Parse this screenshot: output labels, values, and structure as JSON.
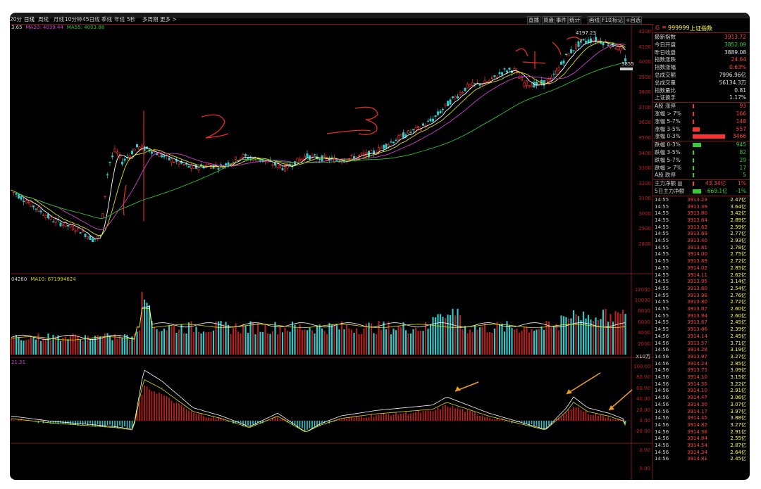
{
  "tabs": [
    "20分",
    "日线",
    "周线",
    "月线",
    "10分钟",
    "45日线",
    "季线",
    "年线",
    "5秒",
    "多周期",
    "更多 >"
  ],
  "right_tabs": [
    "直播",
    "買盘",
    "事件",
    "统计",
    "画线",
    "F10",
    "标记",
    "+自选"
  ],
  "legends": {
    "price": [
      {
        "text": "3.65",
        "color": "#d0d0d0"
      },
      {
        "text": "MA20: 4039.44",
        "color": "#d040d0"
      },
      {
        "text": "MA55: 4003.68",
        "color": "#30c030"
      }
    ],
    "volume": [
      {
        "text": "04280",
        "color": "#d0d0d0"
      },
      {
        "text": "MA10: 671994624",
        "color": "#d0d000"
      }
    ],
    "macd": [
      {
        "text": "21.31",
        "color": "#d040d0"
      }
    ],
    "peak_label": "4197.23",
    "right_label": "3855"
  },
  "price_axis": [
    "4200",
    "4100",
    "4000",
    "3900",
    "3800",
    "3700",
    "3600",
    "3500",
    "3400",
    "3300",
    "3200",
    "3100",
    "3000",
    "2900",
    "2800"
  ],
  "volume_axis": [
    "12000",
    "10000",
    "8000",
    "6000",
    "4000",
    "2000"
  ],
  "volume_unit": "X10万",
  "macd_axis": [
    "100.00",
    "80.00",
    "60.00",
    "40.00",
    "20.00",
    "0.00",
    "-20.00"
  ],
  "macd_axis_extra": [
    "0.00",
    "0.00"
  ],
  "index": {
    "code_prefix": "G",
    "code": "999999",
    "name": "上证指数"
  },
  "stats": [
    {
      "label": "最新指数",
      "value": "3913.72",
      "color": "#ff4040"
    },
    {
      "label": "今日开盘",
      "value": "3852.09",
      "color": "#30d030"
    },
    {
      "label": "昨日收盘",
      "value": "3889.08",
      "color": "#e0e0e0"
    },
    {
      "label": "指数涨跌",
      "value": "24.64",
      "color": "#ff4040"
    },
    {
      "label": "指数涨幅",
      "value": "0.63%",
      "color": "#ff4040"
    },
    {
      "label": "总成交额",
      "value": "7996.96亿",
      "color": "#e0e0e0"
    },
    {
      "label": "总成交量",
      "value": "56134.3万",
      "color": "#e0e0e0"
    },
    {
      "label": "指数量比",
      "value": "0.81",
      "color": "#e0e0e0"
    },
    {
      "label": "上证换手",
      "value": "1.17%",
      "color": "#e0e0e0"
    }
  ],
  "breadth": [
    {
      "label": "A股 涨停",
      "value": "93",
      "color": "#ff4040",
      "bar": 0.02,
      "bar_color": "#ff3030"
    },
    {
      "label": "涨幅 > 7%",
      "value": "166",
      "color": "#ff4040",
      "bar": 0.03,
      "bar_color": "#ff3030"
    },
    {
      "label": "涨幅 5-7%",
      "value": "148",
      "color": "#ff4040",
      "bar": 0.03,
      "bar_color": "#ff3030"
    },
    {
      "label": "涨幅 3-5%",
      "value": "557",
      "color": "#ff4040",
      "bar": 0.22,
      "bar_color": "#ff3030"
    },
    {
      "label": "涨幅 0-3%",
      "value": "3466",
      "color": "#ff4040",
      "bar": 1.0,
      "bar_color": "#ff3030"
    },
    {
      "label": "跌幅 0-3%",
      "value": "945",
      "color": "#30d030",
      "bar": 0.26,
      "bar_color": "#30d030"
    },
    {
      "label": "跌幅 3-5%",
      "value": "82",
      "color": "#30d030",
      "bar": 0.02,
      "bar_color": "#30d030"
    },
    {
      "label": "跌幅 5-7%",
      "value": "29",
      "color": "#30d030",
      "bar": 0.01,
      "bar_color": "#30d030"
    },
    {
      "label": "跌幅 > 7%",
      "value": "17",
      "color": "#30d030",
      "bar": 0.01,
      "bar_color": "#30d030"
    },
    {
      "label": "A股 跌停",
      "value": "5",
      "color": "#30d030",
      "bar": 0.01,
      "bar_color": "#30d030"
    }
  ],
  "flows": [
    {
      "label": "主力净额 ▥",
      "value": "43.34亿",
      "pct": "1%",
      "color": "#ff4040"
    },
    {
      "label": "5日主力净额",
      "value": "-669.1亿",
      "pct": "-1%",
      "color": "#30d030"
    }
  ],
  "ticks": [
    {
      "time": "14:55",
      "price": "3913.23",
      "amount": "2.47亿"
    },
    {
      "time": "14:55",
      "price": "3913.39",
      "amount": "3.64亿"
    },
    {
      "time": "14:55",
      "price": "3913.80",
      "amount": "3.42亿"
    },
    {
      "time": "14:55",
      "price": "3913.64",
      "amount": "2.89亿"
    },
    {
      "time": "14:55",
      "price": "3913.63",
      "amount": "2.59亿"
    },
    {
      "time": "14:55",
      "price": "3913.69",
      "amount": "2.77亿"
    },
    {
      "time": "14:55",
      "price": "3913.40",
      "amount": "2.93亿"
    },
    {
      "time": "14:55",
      "price": "3913.81",
      "amount": "2.78亿"
    },
    {
      "time": "14:55",
      "price": "3914.00",
      "amount": "2.75亿"
    },
    {
      "time": "14:55",
      "price": "3913.89",
      "amount": "2.72亿"
    },
    {
      "time": "14:55",
      "price": "3914.02",
      "amount": "2.85亿"
    },
    {
      "time": "14:55",
      "price": "3914.11",
      "amount": "2.62亿"
    },
    {
      "time": "14:55",
      "price": "3913.95",
      "amount": "3.14亿"
    },
    {
      "time": "14:55",
      "price": "3913.60",
      "amount": "2.54亿"
    },
    {
      "time": "14:55",
      "price": "3913.98",
      "amount": "2.76亿"
    },
    {
      "time": "14:55",
      "price": "3913.80",
      "amount": "2.72亿"
    },
    {
      "time": "14:55",
      "price": "3913.87",
      "amount": "2.60亿"
    },
    {
      "time": "14:55",
      "price": "3913.94",
      "amount": "2.60亿"
    },
    {
      "time": "14:55",
      "price": "3913.67",
      "amount": "2.45亿"
    },
    {
      "time": "14:55",
      "price": "3913.86",
      "amount": "2.39亿"
    },
    {
      "time": "14:56",
      "price": "3914.14",
      "amount": "2.45亿"
    },
    {
      "time": "14:56",
      "price": "3913.57",
      "amount": "3.71亿"
    },
    {
      "time": "14:56",
      "price": "3914.28",
      "amount": "3.19亿"
    },
    {
      "time": "14:56",
      "price": "3913.97",
      "amount": "3.27亿"
    },
    {
      "time": "14:56",
      "price": "3914.24",
      "amount": "2.85亿"
    },
    {
      "time": "14:56",
      "price": "3913.75",
      "amount": "3.09亿"
    },
    {
      "time": "14:56",
      "price": "3914.10",
      "amount": "3.15亿"
    },
    {
      "time": "14:56",
      "price": "3914.35",
      "amount": "3.22亿"
    },
    {
      "time": "14:56",
      "price": "3914.10",
      "amount": "2.91亿"
    },
    {
      "time": "14:56",
      "price": "3914.47",
      "amount": "3.06亿"
    },
    {
      "time": "14:56",
      "price": "3914.30",
      "amount": "3.07亿"
    },
    {
      "time": "14:56",
      "price": "3914.17",
      "amount": "3.97亿"
    },
    {
      "time": "14:56",
      "price": "3914.45",
      "amount": "3.88亿"
    },
    {
      "time": "14:56",
      "price": "3914.82",
      "amount": "3.27亿"
    },
    {
      "time": "14:56",
      "price": "3914.38",
      "amount": "2.91亿"
    },
    {
      "time": "14:56",
      "price": "3914.84",
      "amount": "2.55亿"
    },
    {
      "time": "14:56",
      "price": "3914.54",
      "amount": "2.87亿"
    },
    {
      "time": "14:56",
      "price": "3914.34",
      "amount": "2.64亿"
    },
    {
      "time": "14:56",
      "price": "3914.81",
      "amount": "2.45亿"
    }
  ],
  "colors": {
    "up": "#ff3030",
    "down": "#30c8c8",
    "grid": "#7a1a1a",
    "ma5": "#ffffff",
    "ma10": "#e0e000",
    "ma20": "#d040d0",
    "ma55": "#30c030",
    "annotation": "#e03020",
    "arrow": "#f0a020"
  }
}
